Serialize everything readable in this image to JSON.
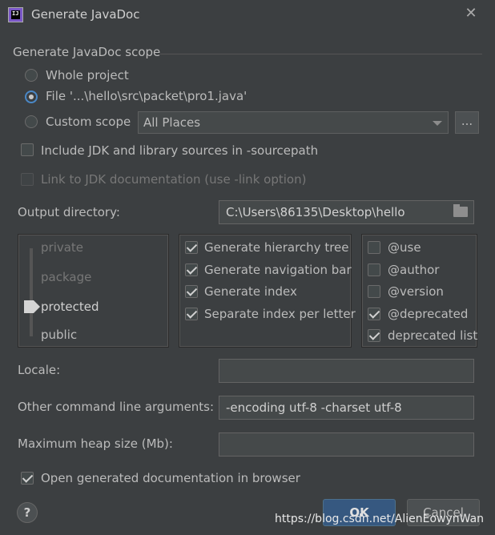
{
  "window": {
    "title": "Generate JavaDoc",
    "close_glyph": "✕"
  },
  "scope": {
    "group_title": "Generate JavaDoc scope",
    "whole_project": "Whole project",
    "file": "File '...\\hello\\src\\packet\\pro1.java'",
    "custom_scope": "Custom scope",
    "custom_scope_value": "All Places",
    "browse_label": "...",
    "include_jdk": "Include JDK and library sources in -sourcepath",
    "link_jdk": "Link to JDK documentation (use -link option)",
    "selected": "file"
  },
  "output": {
    "label": "Output directory:",
    "value": "C:\\Users\\86135\\Desktop\\hello"
  },
  "visibility": {
    "levels": [
      "private",
      "package",
      "protected",
      "public"
    ],
    "selected": "protected"
  },
  "generate_options": [
    {
      "label": "Generate hierarchy tree",
      "checked": true
    },
    {
      "label": "Generate navigation bar",
      "checked": true
    },
    {
      "label": "Generate index",
      "checked": true
    },
    {
      "label": "Separate index per letter",
      "checked": true
    }
  ],
  "tags": [
    {
      "label": "@use",
      "checked": false
    },
    {
      "label": "@author",
      "checked": false
    },
    {
      "label": "@version",
      "checked": false
    },
    {
      "label": "@deprecated",
      "checked": true
    },
    {
      "label": "deprecated list",
      "checked": true
    }
  ],
  "locale": {
    "label": "Locale:",
    "value": ""
  },
  "other_args": {
    "label": "Other command line arguments:",
    "value": "-encoding utf-8 -charset utf-8"
  },
  "heap": {
    "label": "Maximum heap size (Mb):",
    "value": ""
  },
  "open_browser": {
    "label": "Open generated documentation in browser",
    "checked": true
  },
  "buttons": {
    "help": "?",
    "ok": "OK",
    "cancel": "Cancel"
  },
  "watermark": "https://blog.csdn.net/AlienEowynWan",
  "colors": {
    "background": "#3c3f41",
    "accent": "#4a88c7",
    "ok_button": "#365880"
  }
}
